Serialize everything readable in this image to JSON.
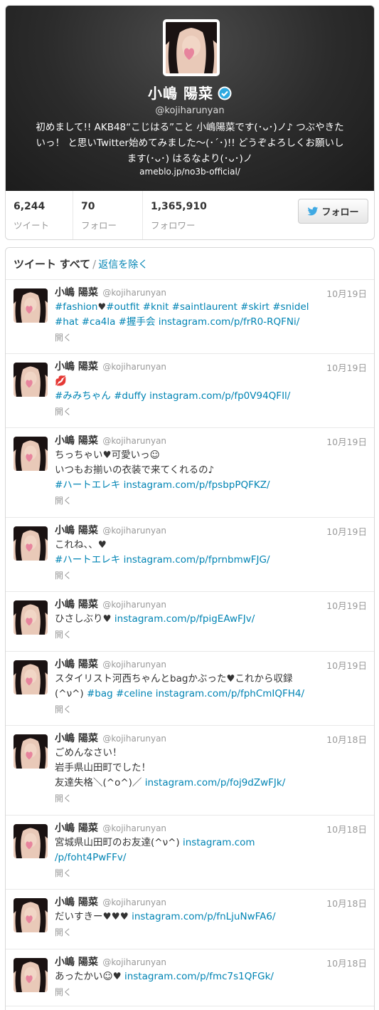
{
  "profile": {
    "name": "小嶋 陽菜",
    "handle": "@kojiharunyan",
    "bio": "初めまして!! AKB48“こじはる”こと 小嶋陽菜です(･ᴗ･)ノ♪ つぶやきたいっ！ と思いTwitter始めてみました〜(･´･)!! どうぞよろしくお願いします(･ᴗ･) はるなより(･ᴗ･)ノ",
    "url": "ameblo.jp/no3b-official/"
  },
  "stats": [
    {
      "value": "6,244",
      "label": "ツイート"
    },
    {
      "value": "70",
      "label": "フォロー"
    },
    {
      "value": "1,365,910",
      "label": "フォロワー"
    }
  ],
  "follow_label": "フォロー",
  "timeline": {
    "title": "ツイート",
    "all_label": "すべて",
    "separator": "/",
    "filter_label": "返信を除く"
  },
  "expand_label": "開く",
  "tweets": [
    {
      "name": "小嶋 陽菜",
      "handle": "@kojiharunyan",
      "date": "10月19日",
      "lines": [
        [
          "#fashion",
          "♥",
          "#outfit #knit #saintlaurent #skirt #snidel"
        ],
        [
          "#hat #ca4la #握手会 instagram.com/p/frR0-RQFNi/"
        ]
      ]
    },
    {
      "name": "小嶋 陽菜",
      "handle": "@kojiharunyan",
      "date": "10月19日",
      "lines": [
        [
          "💋"
        ],
        [
          "#みみちゃん #duffy instagram.com/p/fp0V94QFIl/"
        ]
      ]
    },
    {
      "name": "小嶋 陽菜",
      "handle": "@kojiharunyan",
      "date": "10月19日",
      "lines": [
        [
          "ちっちゃい♥可愛いっ☺"
        ],
        [
          "いつもお揃いの衣装で来てくれるの♪"
        ],
        [
          "#ハートエレキ instagram.com/p/fpsbpPQFKZ/"
        ]
      ]
    },
    {
      "name": "小嶋 陽菜",
      "handle": "@kojiharunyan",
      "date": "10月19日",
      "lines": [
        [
          "これね、、♥"
        ],
        [
          "#ハートエレキ instagram.com/p/fprnbmwFJG/"
        ]
      ]
    },
    {
      "name": "小嶋 陽菜",
      "handle": "@kojiharunyan",
      "date": "10月19日",
      "lines": [
        [
          "ひさしぶり♥ ",
          "instagram.com/p/fpigEAwFJv/"
        ]
      ]
    },
    {
      "name": "小嶋 陽菜",
      "handle": "@kojiharunyan",
      "date": "10月19日",
      "lines": [
        [
          "スタイリスト河西ちゃんとbagかぶった♥これから収録"
        ],
        [
          "(^ν^) ",
          "#bag #celine instagram.com/p/fphCmIQFH4/"
        ]
      ]
    },
    {
      "name": "小嶋 陽菜",
      "handle": "@kojiharunyan",
      "date": "10月18日",
      "lines": [
        [
          "ごめんなさい！"
        ],
        [
          "岩手県山田町でした！"
        ],
        [
          "友達失格＼(^o^)／ ",
          "instagram.com/p/foj9dZwFJk/"
        ]
      ]
    },
    {
      "name": "小嶋 陽菜",
      "handle": "@kojiharunyan",
      "date": "10月18日",
      "lines": [
        [
          "宮城県山田町のお友達(^ν^) ",
          "instagram.com"
        ],
        [
          "/p/foht4PwFFv/"
        ]
      ]
    },
    {
      "name": "小嶋 陽菜",
      "handle": "@kojiharunyan",
      "date": "10月18日",
      "lines": [
        [
          "だいすきー♥♥♥ ",
          "instagram.com/p/fnLjuNwFA6/"
        ]
      ]
    },
    {
      "name": "小嶋 陽菜",
      "handle": "@kojiharunyan",
      "date": "10月18日",
      "lines": [
        [
          "あったかい☺♥ ",
          "instagram.com/p/fmc7s1QFGk/"
        ]
      ]
    }
  ],
  "colors": {
    "link": "#0084b4",
    "header_bg": "#2b2b2b",
    "muted": "#999999"
  }
}
